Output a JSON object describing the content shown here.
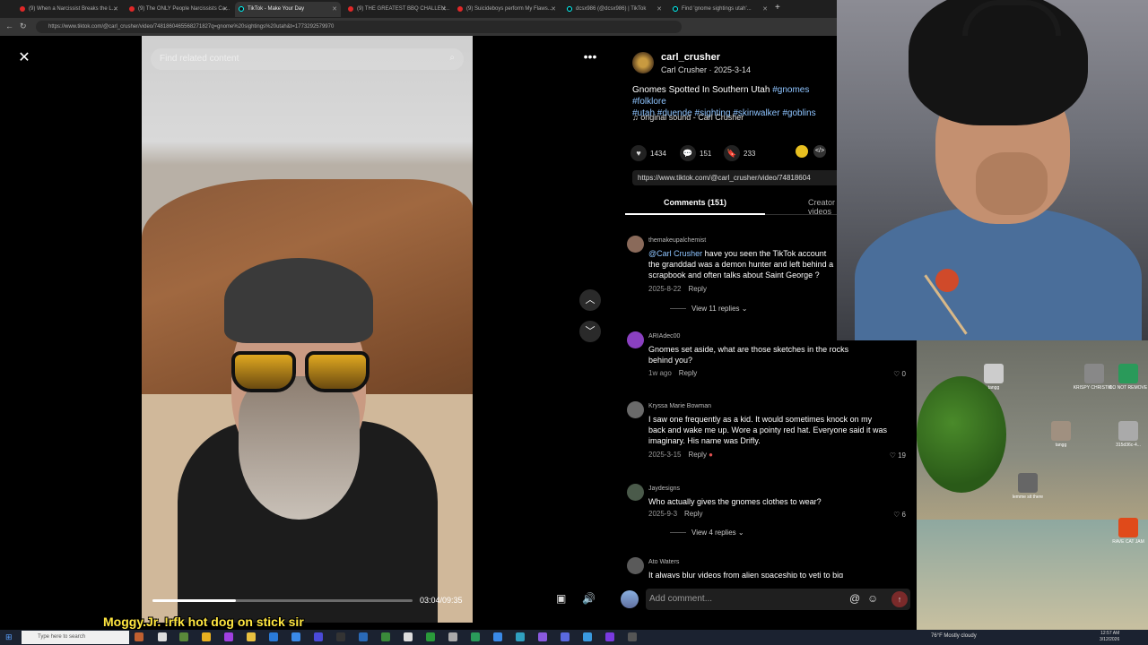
{
  "browser": {
    "tabs": [
      {
        "label": "(9) When a Narcissist Breaks the L...",
        "active": false
      },
      {
        "label": "(9) The ONLY People Narcissists Ca...",
        "active": false
      },
      {
        "label": "TikTok - Make Your Day",
        "active": true
      },
      {
        "label": "(9) THE GREATEST BBQ CHALLEN...",
        "active": false
      },
      {
        "label": "(9) Suicideboys perform My Flaws...",
        "active": false
      },
      {
        "label": "dcsx986 (@dcsx986) | TikTok",
        "active": false
      },
      {
        "label": "Find 'gnome sightings utah'...",
        "active": false
      }
    ],
    "url": "https://www.tiktok.com/@carl_crusher/video/7481860465568271827q=gnome%20sightings%20utah&t=1773292579970"
  },
  "video": {
    "search_placeholder": "Find related content",
    "time": "03:04/09:35",
    "progress": 0.32
  },
  "post": {
    "username": "carl_crusher",
    "subline": "Carl Crusher · 2025-3-14",
    "caption_text": "Gnomes Spotted In Southern Utah ",
    "hashtags_line1": "#gnomes #folklore",
    "hashtags_line2": "#utah #duende #sighting #skinwalker #goblins",
    "sound": "♫ original sound - Carl Crusher",
    "likes": "1434",
    "comments_count": "151",
    "saves": "233",
    "link": "https://www.tiktok.com/@carl_crusher/video/74818604",
    "tab_comments": "Comments (151)",
    "tab_creator": "Creator videos"
  },
  "comments": [
    {
      "user": "themakeupalchemist",
      "mention": "@Carl Crusher",
      "text": " have you seen the TikTok account the granddad was a demon hunter and left behind a scrapbook and often talks about Saint George ?",
      "date": "2025-8-22",
      "reply": "Reply",
      "likes": "",
      "view_replies": "View 11 replies"
    },
    {
      "user": "ARIAdec00",
      "text": "Gnomes set aside, what are those sketches in the rocks behind you?",
      "date": "1w ago",
      "reply": "Reply",
      "likes": "0"
    },
    {
      "user": "Kryssa Marie Bowman",
      "text": "I saw one frequently as a kid. It would sometimes knock on my back and wake me up. Wore a pointy red hat. Everyone said it was imaginary. His name was Drifly.",
      "date": "2025-3-15",
      "reply": "Reply",
      "likes": "19"
    },
    {
      "user": "Jaydesigns",
      "text": "Who actually gives the gnomes clothes to wear?",
      "date": "2025-9-3",
      "reply": "Reply",
      "likes": "6",
      "view_replies": "View 4 replies"
    },
    {
      "user": "Ato Waters",
      "text": "It always blur videos from alien spaceship to yeti to big",
      "date": "",
      "reply": "",
      "likes": ""
    }
  ],
  "comment_input": {
    "placeholder": "Add comment..."
  },
  "stream_chat": "Moggy.Jr. !rfk hot dog on stick sir",
  "desktop_icons": [
    "tangg",
    "KRISPY CHRISTM...",
    "DO NOT REMOVE",
    "tangg",
    "315d36c-4...",
    "lemme sit there",
    "RAVE CAT JAM"
  ],
  "taskbar": {
    "search_placeholder": "Type here to search",
    "weather": "76°F  Mostly cloudy",
    "time": "12:57 AM",
    "date": "3/12/2026"
  }
}
